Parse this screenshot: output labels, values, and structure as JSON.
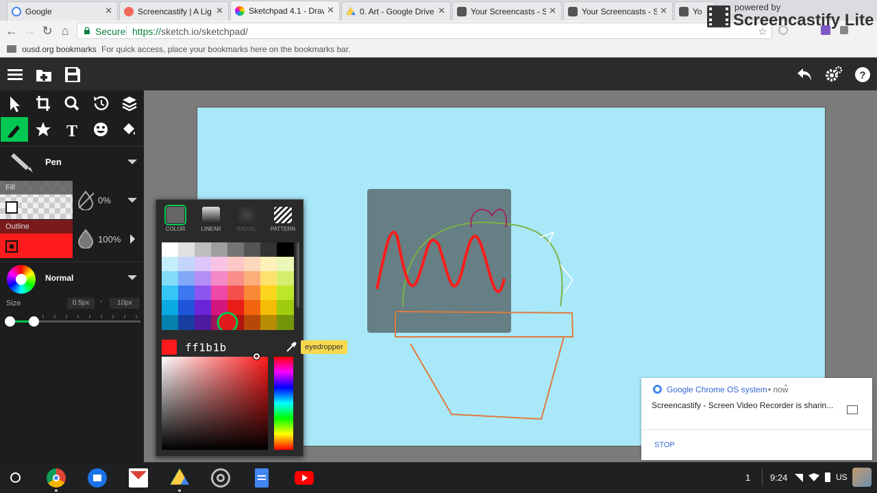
{
  "browser": {
    "tabs": [
      {
        "title": "Google",
        "favicon_color": "#4285f4"
      },
      {
        "title": "Screencastify | A Lig",
        "favicon_color": "#f36a5c"
      },
      {
        "title": "Sketchpad 4.1 - Draw",
        "favicon_color": "#ff6d00"
      },
      {
        "title": "0. Art - Google Drive",
        "favicon_color": "#1fa463"
      },
      {
        "title": "Your Screencasts - Sc",
        "favicon_color": "#555555"
      },
      {
        "title": "Your Screencasts - Sc",
        "favicon_color": "#555555"
      },
      {
        "title": "Yo",
        "favicon_color": "#555555"
      }
    ],
    "active_tab_index": 2,
    "omnibox": {
      "secure_label": "Secure",
      "url_scheme": "https://",
      "url_host": "sketch.io",
      "url_path": "/sketchpad/"
    },
    "bookmarks": {
      "folder_label": "ousd.org bookmarks",
      "hint": "For quick access, place your bookmarks here on the bookmarks bar."
    }
  },
  "watermark": {
    "line1": "powered by",
    "line2": "Screencastify Lite"
  },
  "sketchpad": {
    "top_icons": [
      "menu-icon",
      "open-file-icon",
      "save-icon",
      "undo-icon",
      "settings-icon",
      "help-icon"
    ],
    "tools_row1": [
      "pointer-icon",
      "crop-icon",
      "zoom-icon",
      "history-icon",
      "layers-icon"
    ],
    "tools_row2": [
      "pen-icon",
      "star-icon",
      "text-icon",
      "emoji-icon",
      "fill-bucket-icon"
    ],
    "brush": {
      "name": "Pen"
    },
    "fill": {
      "label": "Fill",
      "opacity": "0%"
    },
    "outline": {
      "label": "Outline",
      "opacity": "100%",
      "color": "#ff1b1b"
    },
    "blend": {
      "mode": "Normal"
    },
    "size": {
      "label": "Size",
      "min": "0.5px",
      "separator": "-",
      "max": "10px"
    },
    "picker": {
      "types": [
        {
          "label": "COLOR",
          "selected": true
        },
        {
          "label": "LINEAR",
          "selected": false
        },
        {
          "label": "RADIAL",
          "selected": false
        },
        {
          "label": "PATTERN",
          "selected": false
        }
      ],
      "hex": "ff1b1b",
      "tooltip": "eyedropper"
    },
    "canvas_color": "#a9e8f8"
  },
  "notification": {
    "source": "Google Chrome OS system",
    "time": "• now",
    "message": "Screencastify - Screen Video Recorder is sharin...",
    "action": "STOP"
  },
  "shelf": {
    "apps": [
      "chrome-icon",
      "files-icon",
      "gmail-icon",
      "drive-icon",
      "screencastify-icon",
      "docs-icon",
      "youtube-icon"
    ],
    "notification_count": "1",
    "time": "9:24",
    "locale": "US"
  }
}
